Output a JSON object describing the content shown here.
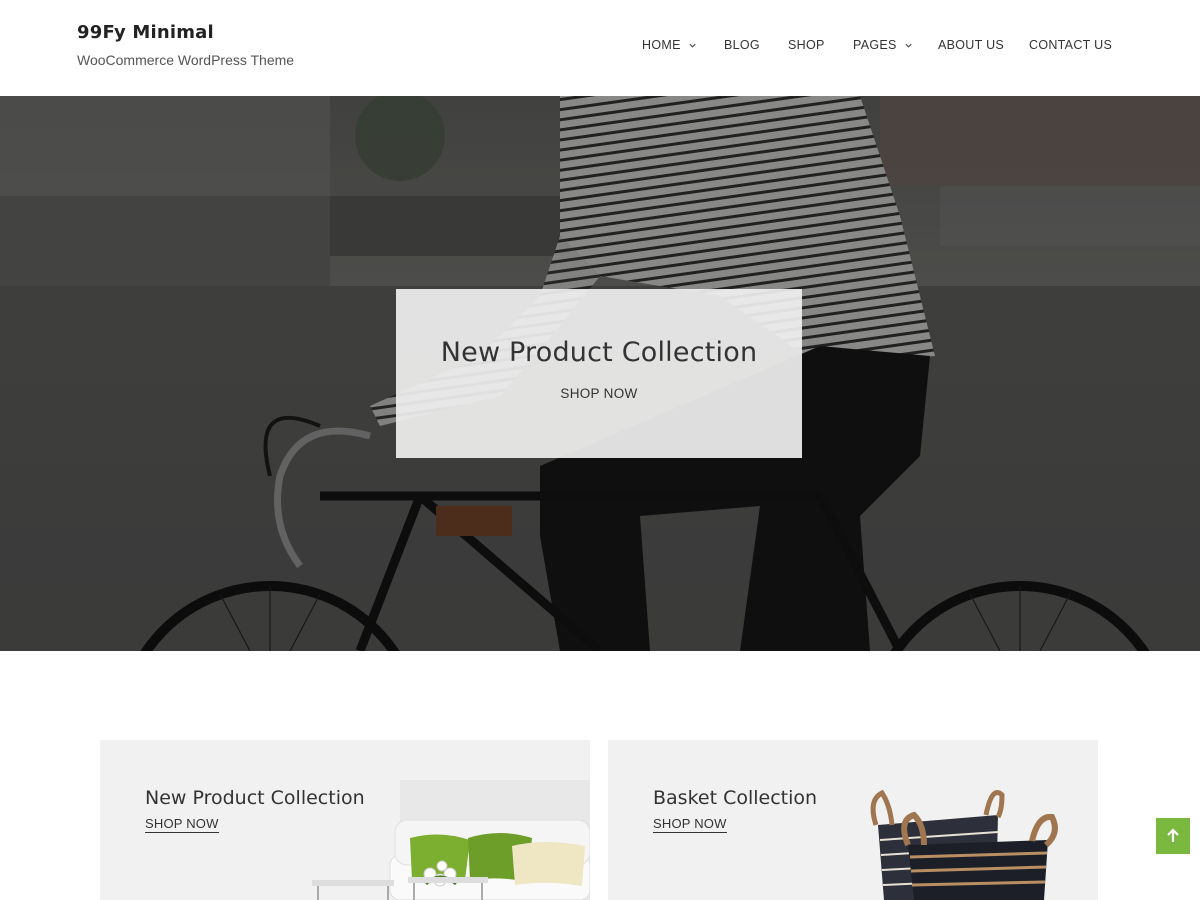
{
  "site": {
    "title": "99Fy Minimal",
    "tagline": "WooCommerce WordPress Theme"
  },
  "nav": {
    "items": [
      {
        "label": "HOME",
        "has_dropdown": true
      },
      {
        "label": "BLOG",
        "has_dropdown": false
      },
      {
        "label": "SHOP",
        "has_dropdown": false
      },
      {
        "label": "PAGES",
        "has_dropdown": true
      },
      {
        "label": "ABOUT US",
        "has_dropdown": false
      },
      {
        "label": "CONTACT US",
        "has_dropdown": false
      }
    ]
  },
  "hero": {
    "title": "New Product Collection",
    "cta": "SHOP NOW"
  },
  "collections": [
    {
      "title": "New Product Collection",
      "cta": "SHOP NOW",
      "image": "sofa-with-cushions"
    },
    {
      "title": "Basket Collection",
      "cta": "SHOP NOW",
      "image": "woven-baskets"
    }
  ],
  "colors": {
    "accent": "#7ab83f",
    "text": "#333333",
    "card_bg": "#f1f1f1"
  },
  "icons": {
    "dropdown": "chevron-down-icon",
    "scroll_top": "arrow-up-icon"
  }
}
